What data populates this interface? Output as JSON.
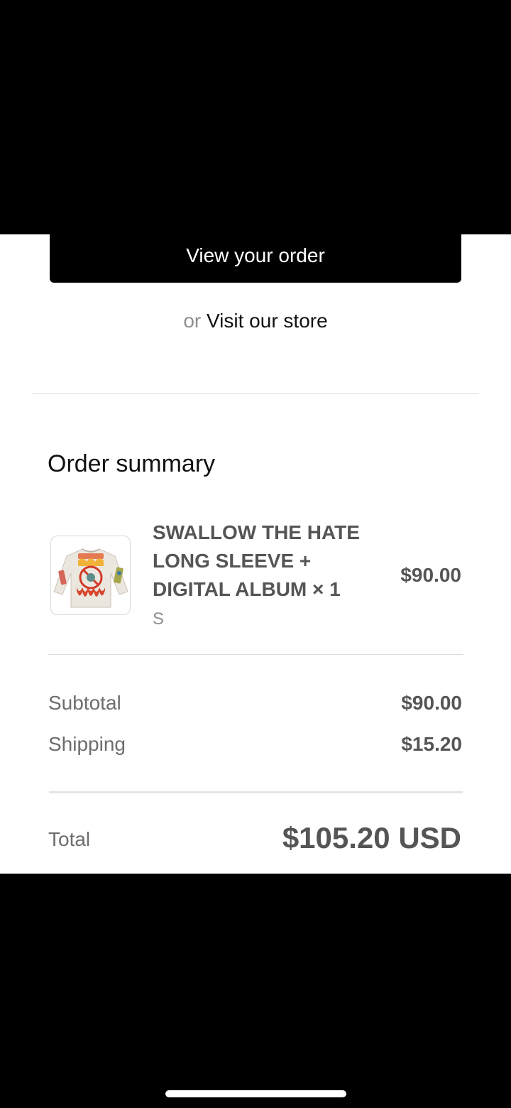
{
  "actions": {
    "view_order_label": "View your order",
    "or_text": "or",
    "visit_store_label": "Visit our store"
  },
  "order_summary": {
    "title": "Order summary",
    "items": [
      {
        "name": "SWALLOW THE HATE LONG SLEEVE + DIGITAL ALBUM × 1",
        "variant": "S",
        "price": "$90.00",
        "thumbnail_icon": "long-sleeve-shirt-image"
      }
    ],
    "subtotal_label": "Subtotal",
    "subtotal_value": "$90.00",
    "shipping_label": "Shipping",
    "shipping_value": "$15.20",
    "total_label": "Total",
    "total_value": "$105.20 USD"
  },
  "colors": {
    "button_bg": "#000000",
    "text_primary": "#111111",
    "text_muted": "#8e8e8e",
    "text_value": "#555555"
  }
}
